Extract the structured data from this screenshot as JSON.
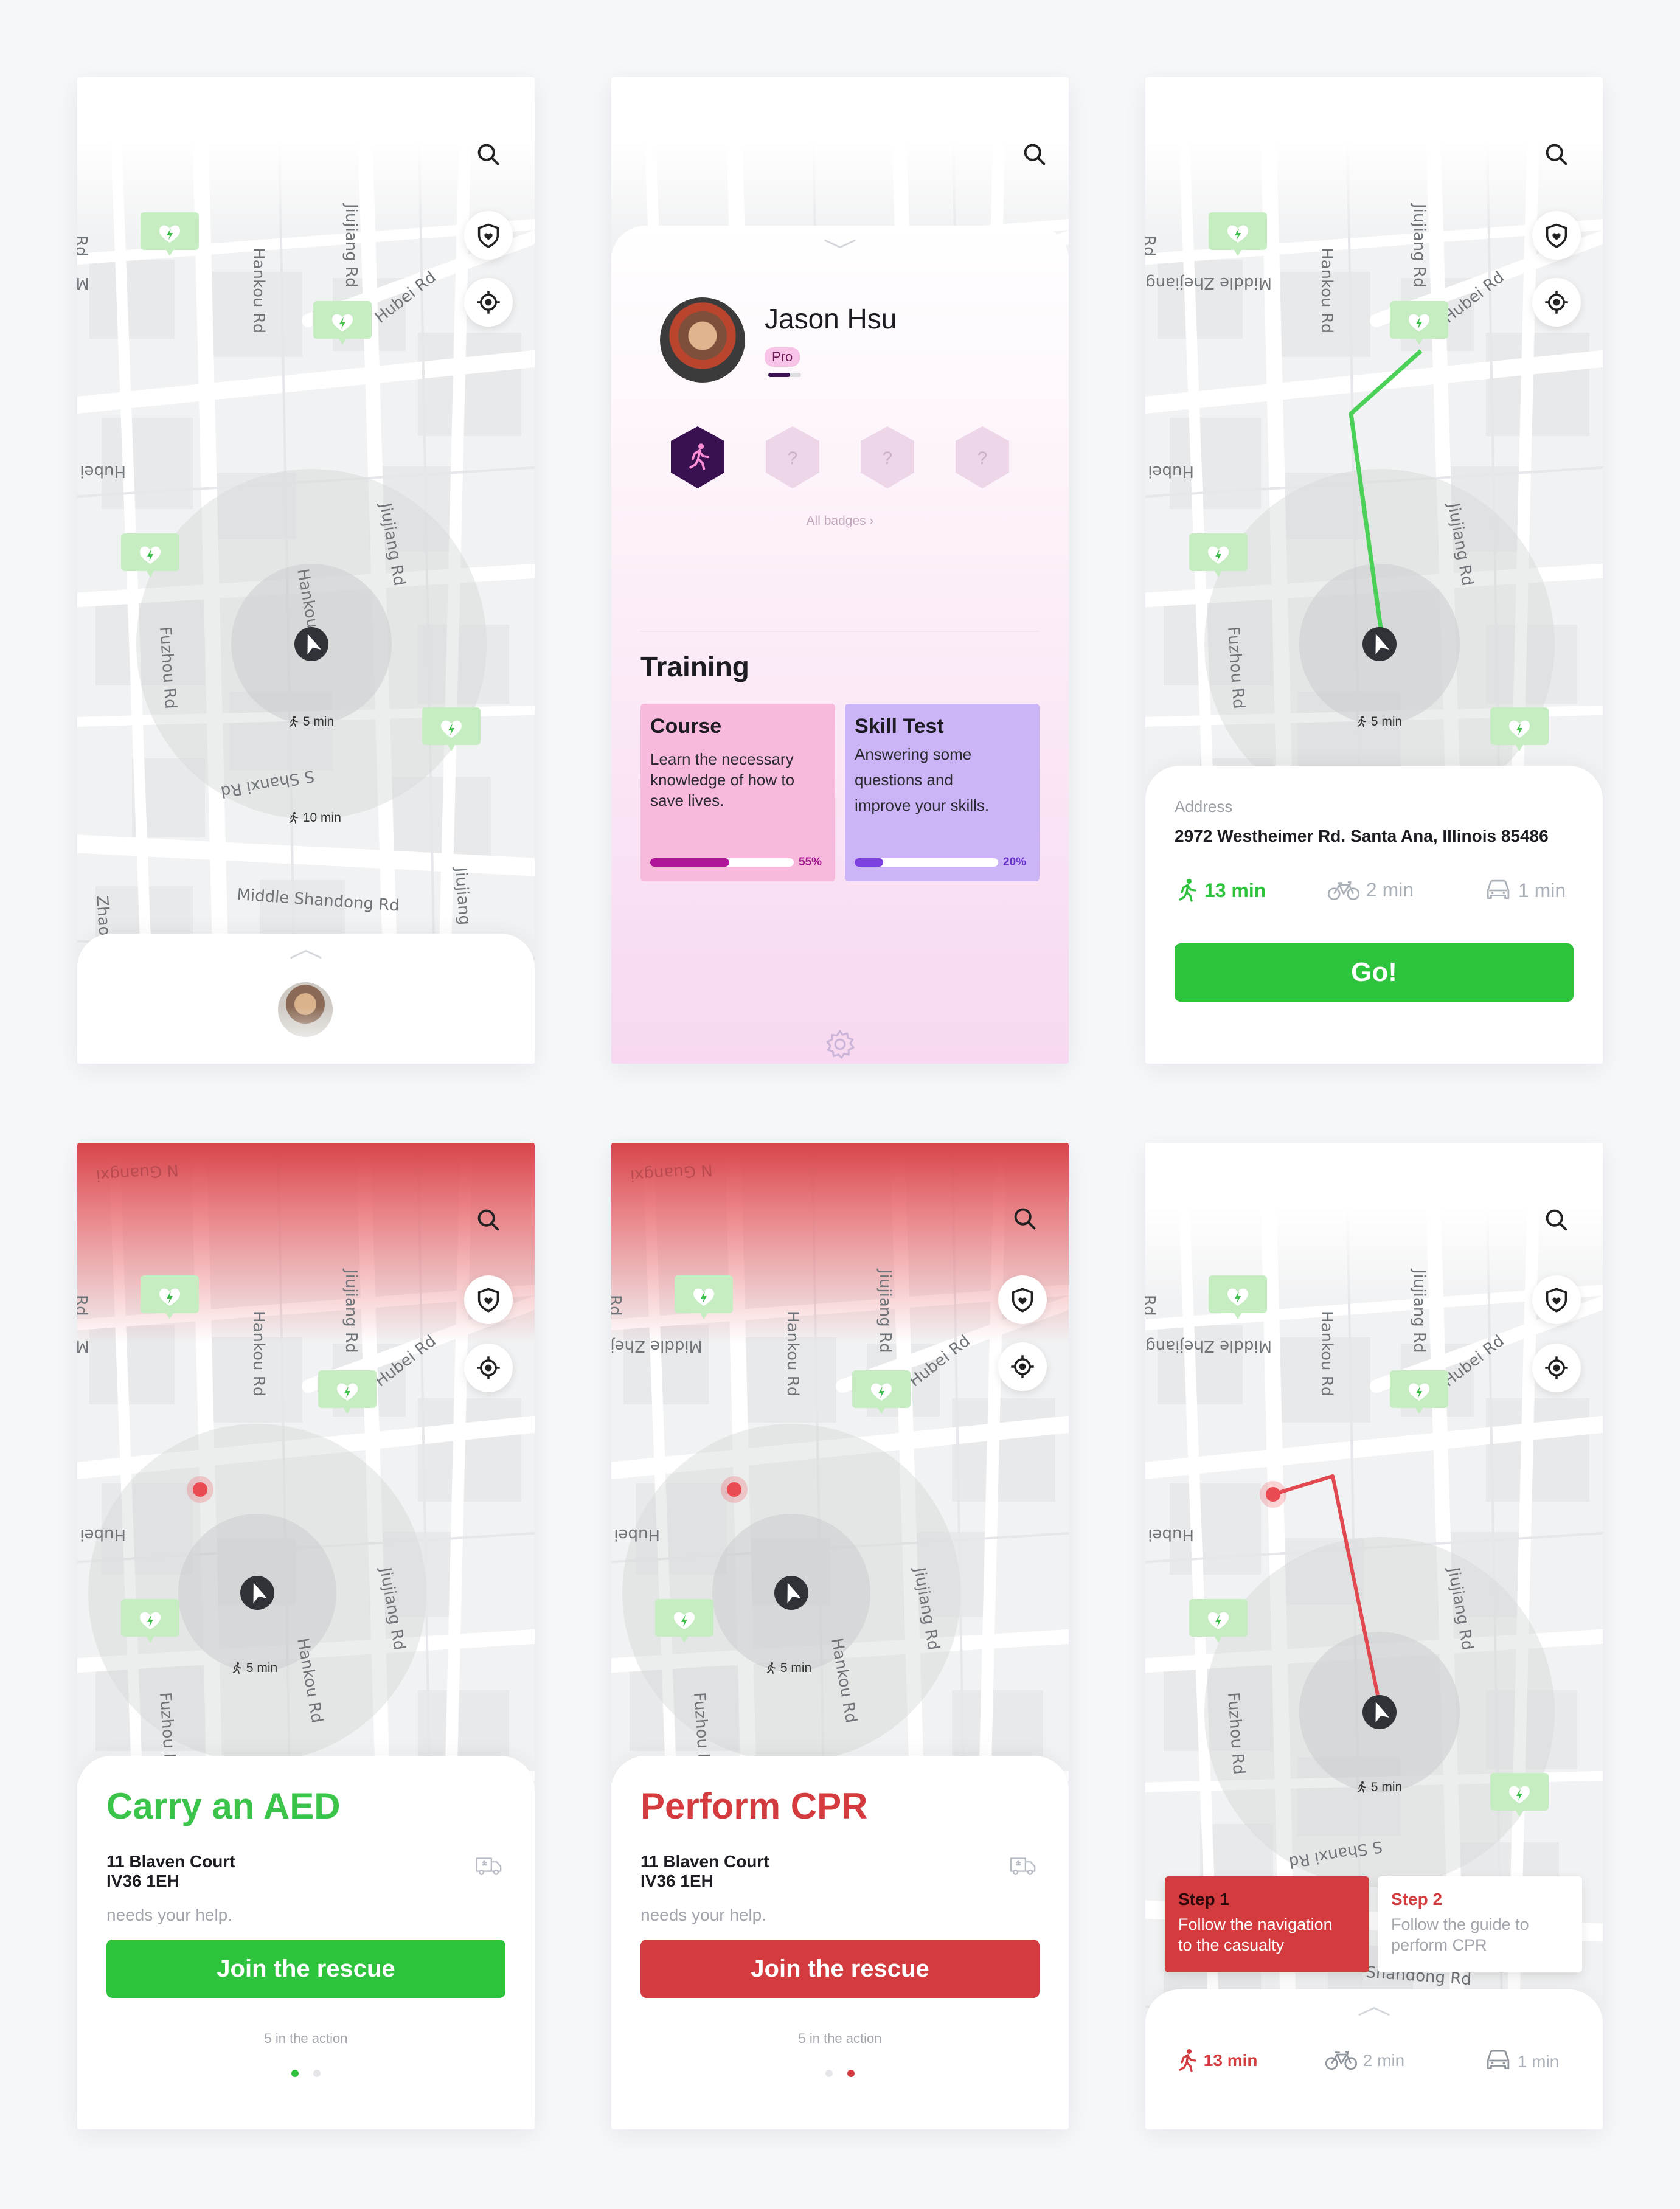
{
  "map_labels": {
    "middle_zhejiang": "Middle Zhejiang",
    "hankou_rd": "Hankou Rd",
    "jiujiang_rd": "Jiujiang Rd",
    "hubei_rd": "Hubei Rd",
    "hubei_left": "Hubei",
    "fuzhou_rd": "Fuzhou Rd",
    "s_shanxi_rd": "S Shanxi Rd",
    "middle_shandong_rd": "Middle Shandong Rd",
    "rd_left": "Rd",
    "zhao": "Zhao",
    "jiujiang": "Jiujiang",
    "n_guangxi": "N Guangxi",
    "shandong_rd": "Shandong Rd",
    "jiu": "Jiu"
  },
  "eta": {
    "five_min": "5 min",
    "ten_min": "10 min"
  },
  "profile": {
    "name": "Jason Hsu",
    "level": "Pro",
    "all_badges": "All badges ›",
    "badge_unknown": "?",
    "training_title": "Training",
    "course": {
      "title": "Course",
      "desc_lines": [
        "Learn the necessary",
        "knowledge of how to",
        "save lives."
      ],
      "progress": 55,
      "progress_label": "55%"
    },
    "skill": {
      "title": "Skill Test",
      "desc_lines": [
        "Answering some",
        "questions and",
        "improve your skills."
      ],
      "progress": 20,
      "progress_label": "20%"
    }
  },
  "route": {
    "address_label": "Address",
    "address": "2972 Westheimer Rd. Santa Ana, Illinois 85486",
    "walk": "13 min",
    "bike": "2 min",
    "car": "1 min",
    "go": "Go!"
  },
  "aed": {
    "title": "Carry an AED",
    "addr1": "11 Blaven Court",
    "addr2": "IV36 1EH",
    "needs": "needs your help.",
    "join": "Join the rescue",
    "action": "5 in the action"
  },
  "cpr": {
    "title": "Perform CPR",
    "addr1": "11 Blaven Court",
    "addr2": "IV36 1EH",
    "needs": "needs your help.",
    "join": "Join the rescue",
    "action": "5 in the action"
  },
  "steps": {
    "step1_title": "Step 1",
    "step1_line1": "Follow the navigation",
    "step1_line2": "to the casualty",
    "step2_title": "Step 2",
    "step2_line1": "Follow the guide to",
    "step2_line2": "perform CPR",
    "walk": "13 min",
    "bike": "2 min",
    "car": "1 min"
  },
  "colors": {
    "green": "#2ec33d",
    "red": "#d33b3f",
    "purple": "#3a1150",
    "course_bg": "#f7b9dc",
    "skill_bg": "#cbb5f7",
    "marker_green": "#c7eec4"
  },
  "icons": [
    "search-icon",
    "shield-heart-icon",
    "locate-icon",
    "navigation-arrow-icon",
    "aed-marker-icon",
    "walk-icon",
    "bike-icon",
    "car-icon",
    "ambulance-icon",
    "gear-icon",
    "chevron-up-icon",
    "chevron-down-icon",
    "runner-badge-icon"
  ]
}
